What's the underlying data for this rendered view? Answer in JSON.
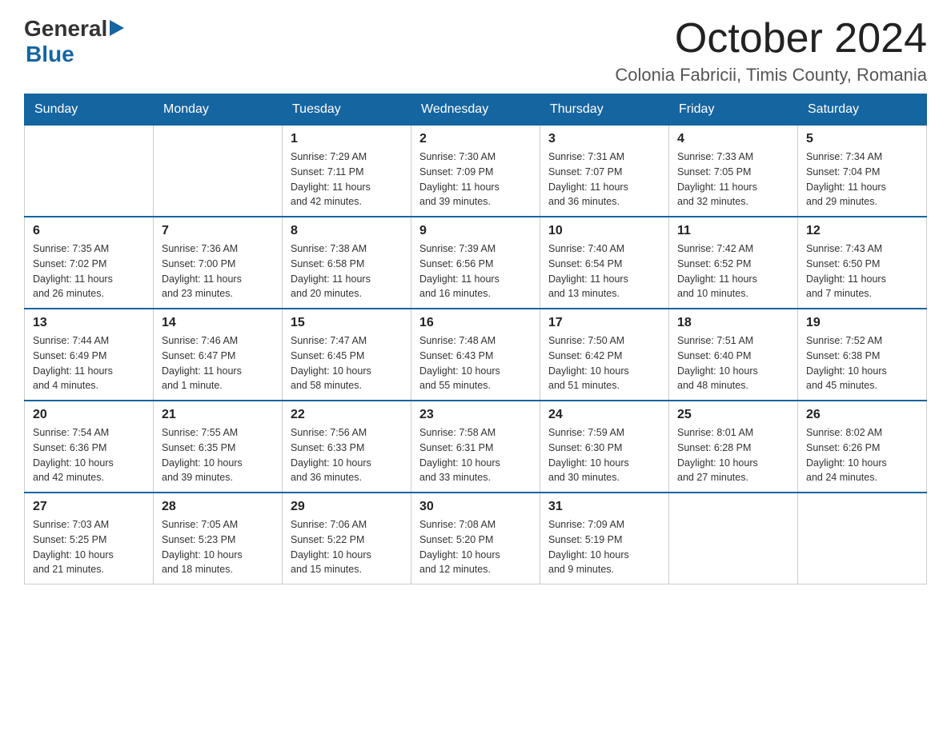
{
  "logo": {
    "general": "General",
    "blue": "Blue"
  },
  "title": "October 2024",
  "location": "Colonia Fabricii, Timis County, Romania",
  "weekdays": [
    "Sunday",
    "Monday",
    "Tuesday",
    "Wednesday",
    "Thursday",
    "Friday",
    "Saturday"
  ],
  "weeks": [
    [
      {
        "day": "",
        "info": ""
      },
      {
        "day": "",
        "info": ""
      },
      {
        "day": "1",
        "info": "Sunrise: 7:29 AM\nSunset: 7:11 PM\nDaylight: 11 hours\nand 42 minutes."
      },
      {
        "day": "2",
        "info": "Sunrise: 7:30 AM\nSunset: 7:09 PM\nDaylight: 11 hours\nand 39 minutes."
      },
      {
        "day": "3",
        "info": "Sunrise: 7:31 AM\nSunset: 7:07 PM\nDaylight: 11 hours\nand 36 minutes."
      },
      {
        "day": "4",
        "info": "Sunrise: 7:33 AM\nSunset: 7:05 PM\nDaylight: 11 hours\nand 32 minutes."
      },
      {
        "day": "5",
        "info": "Sunrise: 7:34 AM\nSunset: 7:04 PM\nDaylight: 11 hours\nand 29 minutes."
      }
    ],
    [
      {
        "day": "6",
        "info": "Sunrise: 7:35 AM\nSunset: 7:02 PM\nDaylight: 11 hours\nand 26 minutes."
      },
      {
        "day": "7",
        "info": "Sunrise: 7:36 AM\nSunset: 7:00 PM\nDaylight: 11 hours\nand 23 minutes."
      },
      {
        "day": "8",
        "info": "Sunrise: 7:38 AM\nSunset: 6:58 PM\nDaylight: 11 hours\nand 20 minutes."
      },
      {
        "day": "9",
        "info": "Sunrise: 7:39 AM\nSunset: 6:56 PM\nDaylight: 11 hours\nand 16 minutes."
      },
      {
        "day": "10",
        "info": "Sunrise: 7:40 AM\nSunset: 6:54 PM\nDaylight: 11 hours\nand 13 minutes."
      },
      {
        "day": "11",
        "info": "Sunrise: 7:42 AM\nSunset: 6:52 PM\nDaylight: 11 hours\nand 10 minutes."
      },
      {
        "day": "12",
        "info": "Sunrise: 7:43 AM\nSunset: 6:50 PM\nDaylight: 11 hours\nand 7 minutes."
      }
    ],
    [
      {
        "day": "13",
        "info": "Sunrise: 7:44 AM\nSunset: 6:49 PM\nDaylight: 11 hours\nand 4 minutes."
      },
      {
        "day": "14",
        "info": "Sunrise: 7:46 AM\nSunset: 6:47 PM\nDaylight: 11 hours\nand 1 minute."
      },
      {
        "day": "15",
        "info": "Sunrise: 7:47 AM\nSunset: 6:45 PM\nDaylight: 10 hours\nand 58 minutes."
      },
      {
        "day": "16",
        "info": "Sunrise: 7:48 AM\nSunset: 6:43 PM\nDaylight: 10 hours\nand 55 minutes."
      },
      {
        "day": "17",
        "info": "Sunrise: 7:50 AM\nSunset: 6:42 PM\nDaylight: 10 hours\nand 51 minutes."
      },
      {
        "day": "18",
        "info": "Sunrise: 7:51 AM\nSunset: 6:40 PM\nDaylight: 10 hours\nand 48 minutes."
      },
      {
        "day": "19",
        "info": "Sunrise: 7:52 AM\nSunset: 6:38 PM\nDaylight: 10 hours\nand 45 minutes."
      }
    ],
    [
      {
        "day": "20",
        "info": "Sunrise: 7:54 AM\nSunset: 6:36 PM\nDaylight: 10 hours\nand 42 minutes."
      },
      {
        "day": "21",
        "info": "Sunrise: 7:55 AM\nSunset: 6:35 PM\nDaylight: 10 hours\nand 39 minutes."
      },
      {
        "day": "22",
        "info": "Sunrise: 7:56 AM\nSunset: 6:33 PM\nDaylight: 10 hours\nand 36 minutes."
      },
      {
        "day": "23",
        "info": "Sunrise: 7:58 AM\nSunset: 6:31 PM\nDaylight: 10 hours\nand 33 minutes."
      },
      {
        "day": "24",
        "info": "Sunrise: 7:59 AM\nSunset: 6:30 PM\nDaylight: 10 hours\nand 30 minutes."
      },
      {
        "day": "25",
        "info": "Sunrise: 8:01 AM\nSunset: 6:28 PM\nDaylight: 10 hours\nand 27 minutes."
      },
      {
        "day": "26",
        "info": "Sunrise: 8:02 AM\nSunset: 6:26 PM\nDaylight: 10 hours\nand 24 minutes."
      }
    ],
    [
      {
        "day": "27",
        "info": "Sunrise: 7:03 AM\nSunset: 5:25 PM\nDaylight: 10 hours\nand 21 minutes."
      },
      {
        "day": "28",
        "info": "Sunrise: 7:05 AM\nSunset: 5:23 PM\nDaylight: 10 hours\nand 18 minutes."
      },
      {
        "day": "29",
        "info": "Sunrise: 7:06 AM\nSunset: 5:22 PM\nDaylight: 10 hours\nand 15 minutes."
      },
      {
        "day": "30",
        "info": "Sunrise: 7:08 AM\nSunset: 5:20 PM\nDaylight: 10 hours\nand 12 minutes."
      },
      {
        "day": "31",
        "info": "Sunrise: 7:09 AM\nSunset: 5:19 PM\nDaylight: 10 hours\nand 9 minutes."
      },
      {
        "day": "",
        "info": ""
      },
      {
        "day": "",
        "info": ""
      }
    ]
  ]
}
